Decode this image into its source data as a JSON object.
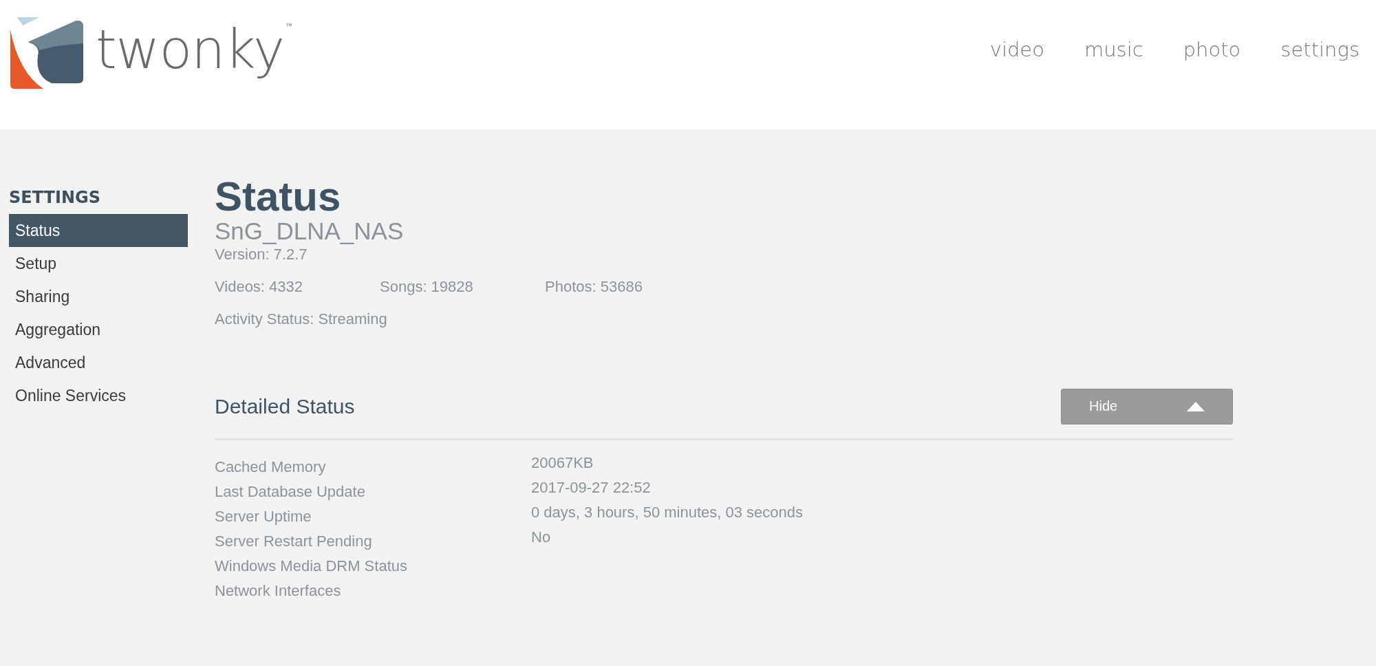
{
  "logo": {
    "wordmark": "twonky",
    "trademark": "™"
  },
  "nav": [
    {
      "label": "video",
      "selected": false
    },
    {
      "label": "music",
      "selected": false
    },
    {
      "label": "photo",
      "selected": false
    },
    {
      "label": "settings",
      "selected": false
    }
  ],
  "sidebar": {
    "heading": "SETTINGS",
    "items": [
      {
        "label": "Status",
        "selected": true
      },
      {
        "label": "Setup",
        "selected": false
      },
      {
        "label": "Sharing",
        "selected": false
      },
      {
        "label": "Aggregation",
        "selected": false
      },
      {
        "label": "Advanced",
        "selected": false
      },
      {
        "label": "Online Services",
        "selected": false
      }
    ]
  },
  "status": {
    "title": "Status",
    "server_name": "SnG_DLNA_NAS",
    "version": "Version: 7.2.7",
    "counts": [
      "Videos: 4332",
      "Songs: 19828",
      "Photos: 53686"
    ],
    "activity": "Activity Status: Streaming"
  },
  "detailed_status": {
    "title": "Detailed Status",
    "toggle_button": "Hide",
    "rows": [
      {
        "label": "Cached Memory",
        "value": "20067KB"
      },
      {
        "label": "Last Database Update",
        "value": "2017-09-27 22:52"
      },
      {
        "label": "Server Uptime",
        "value": "0 days, 3 hours, 50 minutes, 03 seconds"
      },
      {
        "label": "Server Restart Pending",
        "value": "No"
      },
      {
        "label": "Windows Media DRM Status"
      },
      {
        "label": "Network Interfaces"
      }
    ]
  }
}
